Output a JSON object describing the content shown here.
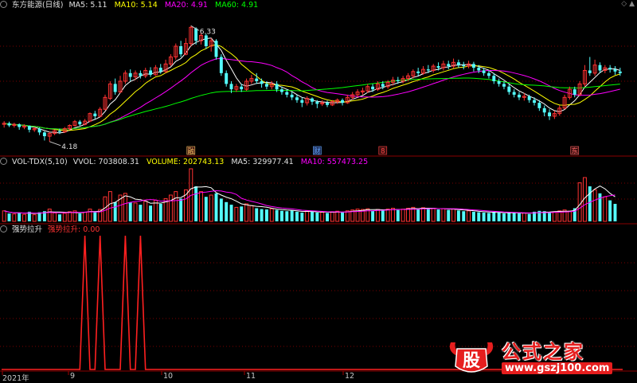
{
  "stock": {
    "name": "东方能源(日线)"
  },
  "price_header": {
    "ma5_label": "MA5: 5.11",
    "ma10_label": "MA10: 5.14",
    "ma20_label": "MA20: 4.91",
    "ma60_label": "MA60: 4.91"
  },
  "volume_header": {
    "name": "VOL-TDX(5,10)",
    "vvol": "VVOL: 703808.31",
    "volume": "VOLUME: 202743.13",
    "ma5": "MA5: 329977.41",
    "ma10": "MA10: 557473.25"
  },
  "indicator_header": {
    "name": "强势拉升",
    "value": "强势拉升: 0.00"
  },
  "corner_mark": "◇ ▲",
  "watermark": {
    "logo_text": "股",
    "title": "公式之家",
    "url": "www.gszj100.com"
  },
  "colors": {
    "up": "#ff3232",
    "down": "#54fcfc",
    "ma5": "#ffffff",
    "ma10": "#ffff00",
    "ma20": "#ff00ff",
    "ma60": "#00ff00",
    "signal": "#ff2020",
    "grid": "#7a0000"
  },
  "chart_data": [
    {
      "type": "candlestick",
      "title": "东方能源(日线)",
      "high_label": "6.33",
      "low_label": "4.18",
      "ylim": [
        4.0,
        6.6
      ],
      "series": [
        {
          "name": "MA5",
          "value": 5.11
        },
        {
          "name": "MA10",
          "value": 5.14
        },
        {
          "name": "MA20",
          "value": 4.91
        },
        {
          "name": "MA60",
          "value": 4.91
        }
      ],
      "candles": [
        [
          4.5,
          4.52,
          4.56,
          4.44
        ],
        [
          4.52,
          4.48,
          4.55,
          4.45
        ],
        [
          4.48,
          4.5,
          4.53,
          4.44
        ],
        [
          4.5,
          4.45,
          4.52,
          4.4
        ],
        [
          4.45,
          4.47,
          4.5,
          4.41
        ],
        [
          4.47,
          4.4,
          4.48,
          4.35
        ],
        [
          4.4,
          4.42,
          4.45,
          4.36
        ],
        [
          4.42,
          4.35,
          4.44,
          4.3
        ],
        [
          4.35,
          4.28,
          4.37,
          4.2
        ],
        [
          4.28,
          4.33,
          4.36,
          4.18
        ],
        [
          4.33,
          4.38,
          4.4,
          4.3
        ],
        [
          4.38,
          4.36,
          4.42,
          4.32
        ],
        [
          4.36,
          4.42,
          4.45,
          4.34
        ],
        [
          4.42,
          4.48,
          4.5,
          4.4
        ],
        [
          4.48,
          4.55,
          4.58,
          4.46
        ],
        [
          4.55,
          4.5,
          4.58,
          4.47
        ],
        [
          4.5,
          4.56,
          4.6,
          4.48
        ],
        [
          4.56,
          4.7,
          4.72,
          4.54
        ],
        [
          4.7,
          4.65,
          4.75,
          4.6
        ],
        [
          4.65,
          4.78,
          4.82,
          4.63
        ],
        [
          4.78,
          5.0,
          5.05,
          4.76
        ],
        [
          4.98,
          5.25,
          5.3,
          4.95
        ],
        [
          5.25,
          5.1,
          5.35,
          5.05
        ],
        [
          5.1,
          5.3,
          5.4,
          5.08
        ],
        [
          5.3,
          5.45,
          5.5,
          5.25
        ],
        [
          5.45,
          5.38,
          5.52,
          5.3
        ],
        [
          5.38,
          5.45,
          5.5,
          5.32
        ],
        [
          5.45,
          5.4,
          5.5,
          5.35
        ],
        [
          5.4,
          5.5,
          5.55,
          5.36
        ],
        [
          5.5,
          5.42,
          5.56,
          5.38
        ],
        [
          5.42,
          5.55,
          5.6,
          5.4
        ],
        [
          5.55,
          5.48,
          5.62,
          5.44
        ],
        [
          5.48,
          5.62,
          5.7,
          5.45
        ],
        [
          5.62,
          5.75,
          5.8,
          5.58
        ],
        [
          5.75,
          5.95,
          6.0,
          5.7
        ],
        [
          5.95,
          5.8,
          6.05,
          5.75
        ],
        [
          5.8,
          6.0,
          6.1,
          5.78
        ],
        [
          6.0,
          6.3,
          6.33,
          5.95
        ],
        [
          6.28,
          6.05,
          6.3,
          5.98
        ],
        [
          6.05,
          6.15,
          6.2,
          5.98
        ],
        [
          6.15,
          5.95,
          6.18,
          5.9
        ],
        [
          5.95,
          6.05,
          6.1,
          5.85
        ],
        [
          6.05,
          5.75,
          6.08,
          5.7
        ],
        [
          5.75,
          5.45,
          5.8,
          5.4
        ],
        [
          5.45,
          5.25,
          5.5,
          5.2
        ],
        [
          5.25,
          5.15,
          5.3,
          5.08
        ],
        [
          5.15,
          5.2,
          5.25,
          5.1
        ],
        [
          5.2,
          5.15,
          5.25,
          5.1
        ],
        [
          5.15,
          5.3,
          5.35,
          5.12
        ],
        [
          5.3,
          5.35,
          5.42,
          5.25
        ],
        [
          5.35,
          5.3,
          5.45,
          5.25
        ],
        [
          5.3,
          5.25,
          5.35,
          5.18
        ],
        [
          5.25,
          5.2,
          5.3,
          5.15
        ],
        [
          5.2,
          5.25,
          5.3,
          5.15
        ],
        [
          5.25,
          5.15,
          5.3,
          5.1
        ],
        [
          5.15,
          5.1,
          5.2,
          5.05
        ],
        [
          5.1,
          5.05,
          5.15,
          5.0
        ],
        [
          5.05,
          5.0,
          5.1,
          4.95
        ],
        [
          5.0,
          4.95,
          5.05,
          4.9
        ],
        [
          4.95,
          4.9,
          5.0,
          4.82
        ],
        [
          4.9,
          4.98,
          5.02,
          4.85
        ],
        [
          4.98,
          4.92,
          5.0,
          4.86
        ],
        [
          4.92,
          4.88,
          4.95,
          4.8
        ],
        [
          4.88,
          4.9,
          4.95,
          4.84
        ],
        [
          4.9,
          4.86,
          4.94,
          4.82
        ],
        [
          4.86,
          4.92,
          4.95,
          4.84
        ],
        [
          4.92,
          4.95,
          4.98,
          4.88
        ],
        [
          4.95,
          4.9,
          4.98,
          4.85
        ],
        [
          4.9,
          5.0,
          5.05,
          4.88
        ],
        [
          5.0,
          5.05,
          5.1,
          4.96
        ],
        [
          5.05,
          5.1,
          5.15,
          5.0
        ],
        [
          5.1,
          5.12,
          5.18,
          5.05
        ],
        [
          5.12,
          5.2,
          5.25,
          5.08
        ],
        [
          5.2,
          5.15,
          5.25,
          5.1
        ],
        [
          5.15,
          5.25,
          5.3,
          5.12
        ],
        [
          5.25,
          5.2,
          5.3,
          5.15
        ],
        [
          5.2,
          5.28,
          5.32,
          5.16
        ],
        [
          5.28,
          5.32,
          5.38,
          5.22
        ],
        [
          5.32,
          5.3,
          5.38,
          5.25
        ],
        [
          5.3,
          5.35,
          5.4,
          5.26
        ],
        [
          5.35,
          5.4,
          5.45,
          5.3
        ],
        [
          5.4,
          5.48,
          5.52,
          5.35
        ],
        [
          5.48,
          5.45,
          5.55,
          5.4
        ],
        [
          5.45,
          5.52,
          5.58,
          5.42
        ],
        [
          5.52,
          5.5,
          5.6,
          5.45
        ],
        [
          5.5,
          5.58,
          5.62,
          5.46
        ],
        [
          5.58,
          5.55,
          5.65,
          5.5
        ],
        [
          5.55,
          5.62,
          5.68,
          5.5
        ],
        [
          5.62,
          5.58,
          5.68,
          5.52
        ],
        [
          5.58,
          5.65,
          5.72,
          5.54
        ],
        [
          5.65,
          5.6,
          5.7,
          5.55
        ],
        [
          5.6,
          5.58,
          5.66,
          5.52
        ],
        [
          5.58,
          5.62,
          5.68,
          5.54
        ],
        [
          5.62,
          5.55,
          5.66,
          5.48
        ],
        [
          5.55,
          5.5,
          5.6,
          5.45
        ],
        [
          5.5,
          5.45,
          5.55,
          5.4
        ],
        [
          5.45,
          5.4,
          5.5,
          5.35
        ],
        [
          5.4,
          5.3,
          5.45,
          5.25
        ],
        [
          5.3,
          5.25,
          5.35,
          5.2
        ],
        [
          5.25,
          5.2,
          5.3,
          5.15
        ],
        [
          5.2,
          5.1,
          5.25,
          5.05
        ],
        [
          5.1,
          5.05,
          5.15,
          5.0
        ],
        [
          5.05,
          5.0,
          5.1,
          4.95
        ],
        [
          5.0,
          5.02,
          5.08,
          4.94
        ],
        [
          5.02,
          4.95,
          5.05,
          4.9
        ],
        [
          4.95,
          4.9,
          5.0,
          4.85
        ],
        [
          4.9,
          4.8,
          4.95,
          4.75
        ],
        [
          4.8,
          4.72,
          4.85,
          4.65
        ],
        [
          4.72,
          4.65,
          4.78,
          4.58
        ],
        [
          4.65,
          4.7,
          4.75,
          4.6
        ],
        [
          4.7,
          4.8,
          4.85,
          4.66
        ],
        [
          4.8,
          5.0,
          5.05,
          4.78
        ],
        [
          5.0,
          5.15,
          5.2,
          4.96
        ],
        [
          5.15,
          5.05,
          5.2,
          5.0
        ],
        [
          5.05,
          5.25,
          5.3,
          5.02
        ],
        [
          5.25,
          5.5,
          5.6,
          5.2
        ],
        [
          5.5,
          5.45,
          5.75,
          5.4
        ],
        [
          5.45,
          5.6,
          5.7,
          5.4
        ],
        [
          5.6,
          5.5,
          5.65,
          5.45
        ],
        [
          5.5,
          5.55,
          5.6,
          5.45
        ],
        [
          5.55,
          5.52,
          5.6,
          5.46
        ],
        [
          5.52,
          5.48,
          5.58,
          5.42
        ],
        [
          5.48,
          5.45,
          5.55,
          5.4
        ]
      ],
      "volumes": [
        60,
        45,
        42,
        50,
        40,
        55,
        38,
        52,
        58,
        70,
        48,
        40,
        46,
        55,
        60,
        45,
        52,
        70,
        55,
        68,
        140,
        170,
        110,
        150,
        160,
        110,
        105,
        95,
        115,
        90,
        120,
        100,
        130,
        150,
        170,
        130,
        180,
        300,
        200,
        170,
        140,
        150,
        160,
        130,
        110,
        95,
        80,
        85,
        100,
        90,
        75,
        70,
        68,
        72,
        65,
        60,
        58,
        62,
        55,
        50,
        60,
        55,
        50,
        52,
        48,
        55,
        58,
        50,
        60,
        65,
        70,
        68,
        72,
        60,
        68,
        62,
        70,
        75,
        65,
        70,
        75,
        80,
        72,
        78,
        70,
        75,
        68,
        72,
        65,
        70,
        62,
        58,
        60,
        55,
        52,
        50,
        48,
        55,
        50,
        45,
        48,
        50,
        45,
        48,
        42,
        55,
        60,
        58,
        50,
        55,
        60,
        65,
        58,
        75,
        220,
        250,
        200,
        180,
        160,
        140,
        120,
        100
      ],
      "signal_positions": [
        16,
        19,
        24,
        27
      ]
    },
    {
      "type": "bar",
      "title": "VOL-TDX(5,10)"
    },
    {
      "type": "line",
      "title": "强势拉升",
      "ylim": [
        0,
        1
      ]
    }
  ],
  "date_axis": {
    "labels": [
      "2021年",
      "9",
      "10",
      "11",
      "12"
    ]
  },
  "event_marks": [
    {
      "label": "融"
    },
    {
      "label": "财"
    },
    {
      "label": "8"
    },
    {
      "label": "东"
    }
  ]
}
